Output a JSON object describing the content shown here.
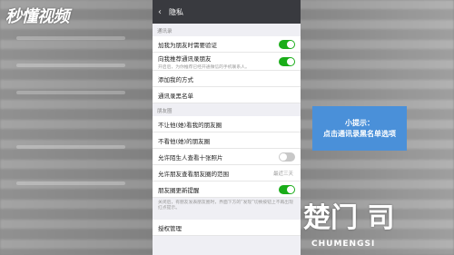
{
  "watermark": "秒懂视频",
  "titlebar": {
    "title": "隐私"
  },
  "sections": {
    "contacts_header": "通讯录",
    "moments_header": "朋友圈"
  },
  "rows": {
    "verify_add": {
      "label": "加我为朋友时需要验证",
      "toggle": "on"
    },
    "recommend": {
      "label": "向我推荐通讯录朋友",
      "toggle": "on",
      "sub": "开启后，为你推荐已经开通微信的手机联系人。"
    },
    "add_methods": {
      "label": "添加我的方式"
    },
    "blacklist": {
      "label": "通讯录黑名单"
    },
    "hide_from": {
      "label": "不让他(她)看我的朋友圈"
    },
    "not_see": {
      "label": "不看他(她)的朋友圈"
    },
    "strangers": {
      "label": "允许陌生人查看十张照片",
      "toggle": "off"
    },
    "visible_range": {
      "label": "允许朋友查看朋友圈的范围",
      "value": "最近三天"
    },
    "update_remind": {
      "label": "朋友圈更新提醒",
      "toggle": "on",
      "note": "关闭后，有朋友发表朋友圈时，界面下方的“发现”切换按钮上不再出现红点提示。"
    },
    "authorize": {
      "label": "授权管理"
    }
  },
  "tip": {
    "title": "小提示：",
    "body": "点击通讯录黑名单选项"
  },
  "logo": {
    "mark": "楚门 司",
    "sub": "CHUMENGSI"
  }
}
